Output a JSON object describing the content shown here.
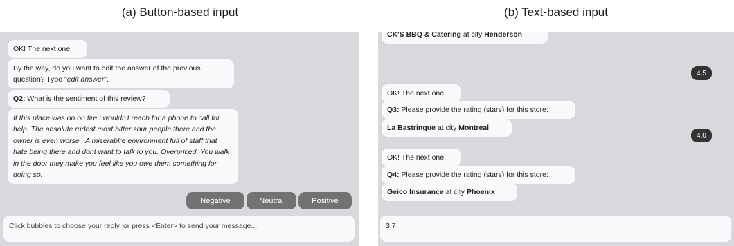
{
  "captions": {
    "a": "(a) Button-based input",
    "b": "(b) Text-based input"
  },
  "panel_a": {
    "msg_next": "OK! The next one.",
    "edit_prompt_prefix": "By the way, do you want to edit the answer of the previous question? Type \"",
    "edit_prompt_cmd": "edit answer",
    "edit_prompt_suffix": "\".",
    "q2_label": "Q2:",
    "q2_text": " What is the sentiment of this review?",
    "review": "If this place was on on fire i wouldn't reach for a phone to call for help. The absolute rudest most bitter sour people there and the owner is even worse . A miserablre environment full of staff that hate being there and dont want to talk to you. Overpriced. You walk in the door they make you feel like you owe them something for doing so.",
    "buttons": {
      "negative": "Negative",
      "neutral": "Neutral",
      "positive": "Positive"
    },
    "input_placeholder": "Click bubbles to choose your reply, or press <Enter> to send your message..."
  },
  "panel_b": {
    "top_store": {
      "name": "CK'S BBQ & Catering",
      "mid": " at city ",
      "city": "Henderson"
    },
    "reply1": "4.5",
    "msg_next_1": "OK! The next one.",
    "q3_label": "Q3:",
    "q_text": " Please provide the rating (stars) for this store:",
    "store1": {
      "name": "La Bastringue",
      "mid": " at city ",
      "city": "Montreal"
    },
    "reply2": "4.0",
    "msg_next_2": "OK! The next one.",
    "q4_label": "Q4:",
    "store2": {
      "name": "Geico Insurance",
      "mid": " at city ",
      "city": "Phoenix"
    },
    "input_value": "3.7"
  }
}
